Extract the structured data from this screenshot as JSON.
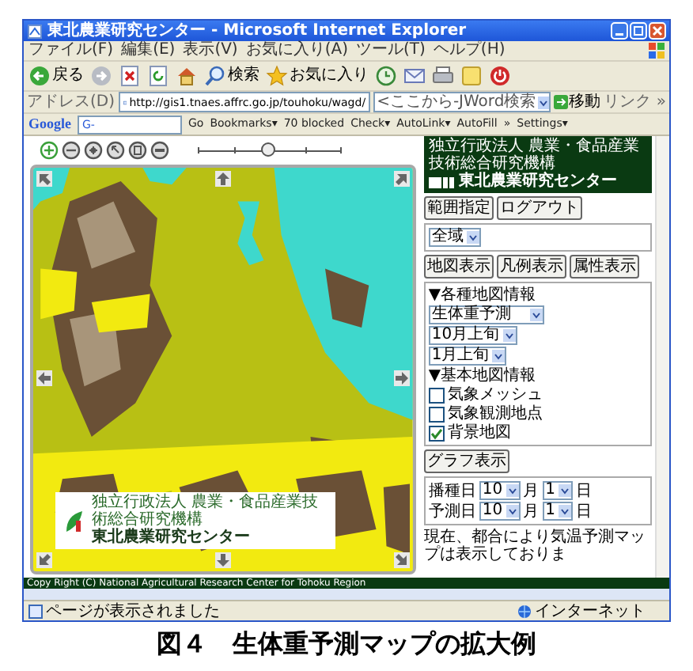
{
  "window": {
    "title": "東北農業研究センター - Microsoft Internet Explorer"
  },
  "menu": [
    "ファイル(F)",
    "編集(E)",
    "表示(V)",
    "お気に入り(A)",
    "ツール(T)",
    "ヘルプ(H)"
  ],
  "toolbar": [
    {
      "kind": "back",
      "label": "戻る"
    },
    {
      "kind": "forward"
    },
    {
      "kind": "stop"
    },
    {
      "kind": "refresh"
    },
    {
      "kind": "home"
    },
    {
      "kind": "search",
      "label": "検索"
    },
    {
      "kind": "favorites",
      "label": "お気に入り"
    },
    {
      "kind": "history"
    },
    {
      "kind": "mail"
    },
    {
      "kind": "print"
    },
    {
      "kind": "note"
    },
    {
      "kind": "power"
    }
  ],
  "address": {
    "label": "アドレス(D)",
    "value": "http://gis1.tnaes.affrc.go.jp/touhoku/wagd/",
    "search_placeholder": "<ここから-JWord検索",
    "go": "移動",
    "links": "リンク »"
  },
  "google_bar": {
    "logo": "Google",
    "field": "G-",
    "items": [
      "Go",
      "Bookmarks▾",
      "70 blocked",
      "Check▾",
      "AutoLink▾",
      "AutoFill",
      "»",
      "Settings▾"
    ]
  },
  "map": {
    "zoom_slider": {
      "level": 0.5
    },
    "logo_org": "独立行政法人 農業・食品産業技術総合研究機構",
    "logo_name": "東北農業研究センター"
  },
  "side": {
    "header_org": "独立行政法人 農業・食品産業技術総合研究機構",
    "header_name": "東北農業研究センター",
    "top_buttons": [
      "範囲指定",
      "ログアウト"
    ],
    "area_select": "全域",
    "view_buttons": [
      "地図表示",
      "凡例表示",
      "属性表示"
    ],
    "map_info": {
      "heading": "▼各種地図情報",
      "selects": [
        "生体重予測",
        "10月上旬",
        "1月上旬"
      ]
    },
    "base_map": {
      "heading": "▼基本地図情報",
      "layers": [
        {
          "label": "気象メッシュ",
          "checked": false
        },
        {
          "label": "気象観測地点",
          "checked": false
        },
        {
          "label": "背景地図",
          "checked": true
        }
      ]
    },
    "graph_button": "グラフ表示",
    "dates": [
      {
        "label": "播種日",
        "month": "10",
        "month_unit": "月",
        "day": "1",
        "day_unit": "日"
      },
      {
        "label": "予測日",
        "month": "10",
        "month_unit": "月",
        "day": "1",
        "day_unit": "日"
      }
    ],
    "notice": "現在、都合により気温予測マップは表示しておりま"
  },
  "copyright": "Copy Right (C) National Agricultural Research Center for Tohoku Region",
  "status_bar": {
    "message": "ページが表示されました",
    "zone": "インターネット"
  },
  "caption": "図４　生体重予測マップの拡大例"
}
